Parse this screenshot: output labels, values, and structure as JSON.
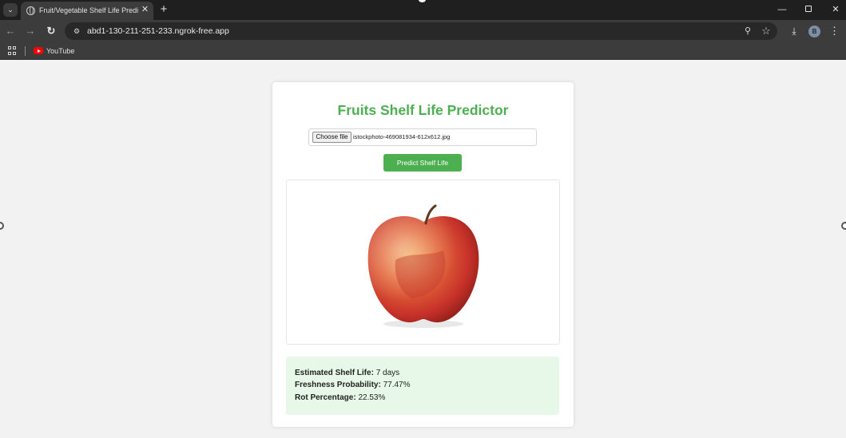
{
  "browser": {
    "tab_title": "Fruit/Vegetable Shelf Life Predic",
    "url": "abd1-130-211-251-233.ngrok-free.app",
    "bookmarks": [
      {
        "label": "YouTube",
        "icon": "youtube-icon"
      }
    ],
    "avatar_initial": "B",
    "icons": {
      "tab_menu": "chevron-down-icon",
      "new_tab": "plus-icon",
      "back": "arrow-left-icon",
      "forward": "arrow-right-icon",
      "reload": "reload-icon",
      "site_info": "tune-icon",
      "zoom": "zoom-icon",
      "bookmark_star": "star-icon",
      "download": "download-icon",
      "menu": "kebab-icon"
    }
  },
  "page": {
    "title": "Fruits Shelf Life Predictor",
    "file_input": {
      "button_label": "Choose file",
      "file_name": "istockphoto-469081934-612x612.jpg"
    },
    "predict_button": "Predict Shelf Life",
    "preview_alt": "apple",
    "results": {
      "shelf_life_label": "Estimated Shelf Life:",
      "shelf_life_value": "7 days",
      "freshness_label": "Freshness Probability:",
      "freshness_value": "77.47%",
      "rot_label": "Rot Percentage:",
      "rot_value": "22.53%"
    }
  },
  "colors": {
    "accent": "#4caf50",
    "result_background": "#e8f8e8",
    "page_background": "#f2f2f2"
  }
}
